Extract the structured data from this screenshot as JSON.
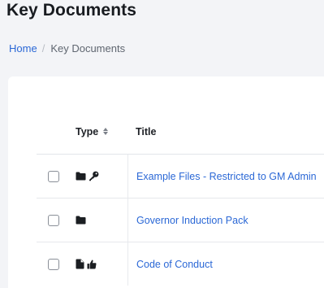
{
  "page": {
    "title": "Key Documents"
  },
  "breadcrumb": {
    "items": [
      {
        "label": "Home",
        "link": true
      },
      {
        "label": "Key Documents",
        "link": false
      }
    ],
    "separator": "/"
  },
  "table": {
    "columns": {
      "type": "Type",
      "title": "Title"
    },
    "rows": [
      {
        "title": "Example Files - Restricted to GM Admin",
        "icons": [
          "folder-icon",
          "key-icon"
        ]
      },
      {
        "title": "Governor Induction Pack",
        "icons": [
          "folder-icon"
        ]
      },
      {
        "title": "Code of Conduct",
        "icons": [
          "file-icon",
          "thumbs-up-icon"
        ]
      }
    ]
  },
  "colors": {
    "link": "#2b68d6",
    "background": "#f3f4f7",
    "card": "#ffffff"
  }
}
